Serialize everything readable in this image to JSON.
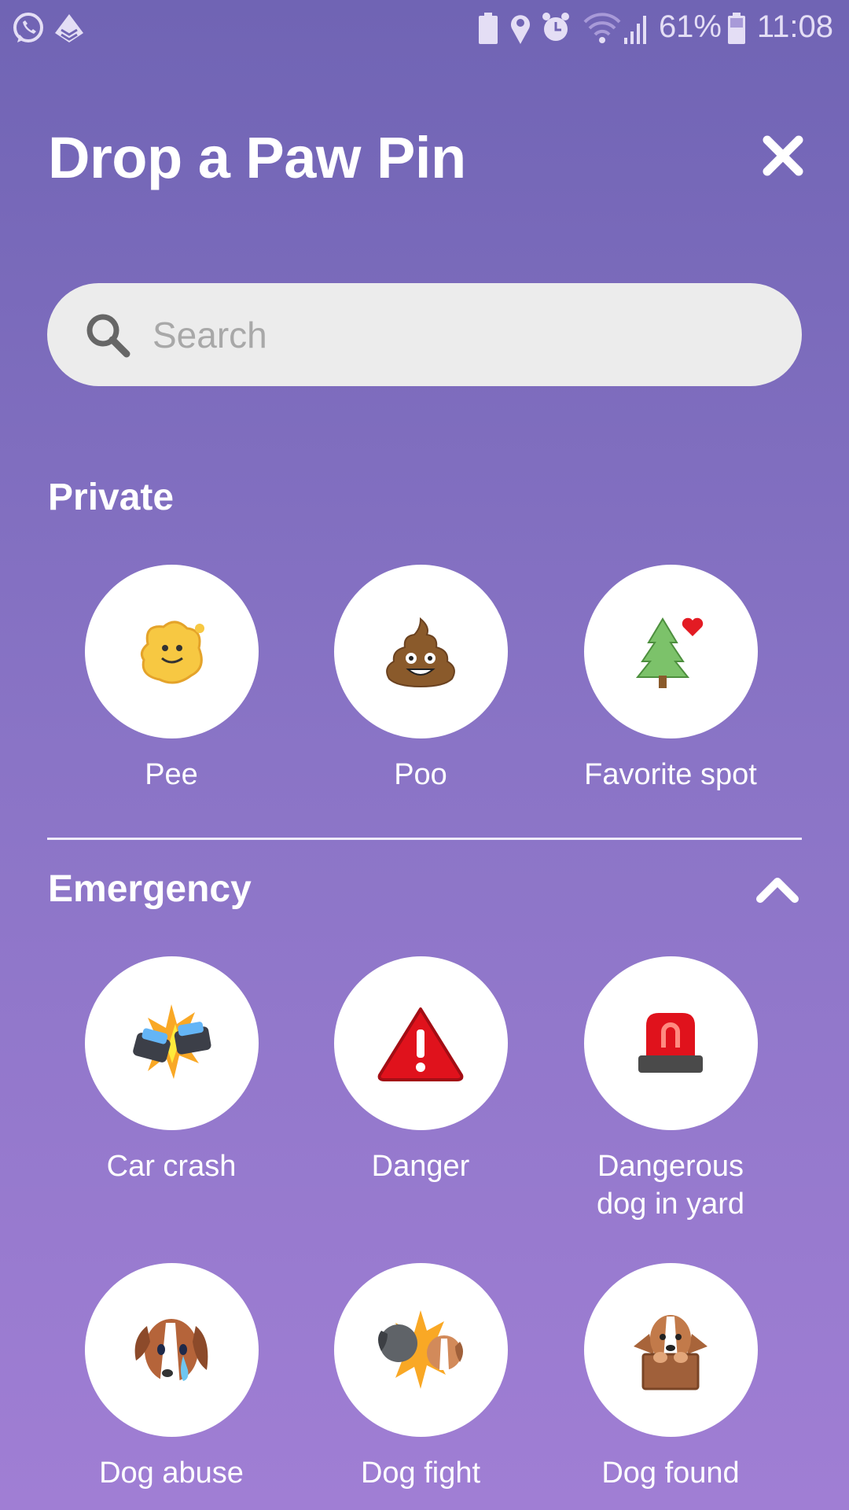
{
  "status_bar": {
    "battery_percent": "61%",
    "time": "11:08",
    "icons": [
      "whatsapp-icon",
      "layers-app-icon",
      "battery-saver-icon",
      "location-icon",
      "alarm-icon",
      "wifi-icon",
      "signal-icon",
      "battery-icon"
    ]
  },
  "header": {
    "title": "Drop a Paw Pin",
    "close_icon": "close-icon"
  },
  "search": {
    "placeholder": "Search",
    "value": ""
  },
  "sections": [
    {
      "title": "Private",
      "items": [
        {
          "label": "Pee",
          "icon": "pee-puddle-icon"
        },
        {
          "label": "Poo",
          "icon": "poo-icon"
        },
        {
          "label": "Favorite spot",
          "icon": "tree-heart-icon"
        }
      ]
    },
    {
      "title": "Emergency",
      "collapse_icon": "chevron-up-icon",
      "items": [
        {
          "label": "Car crash",
          "icon": "car-crash-icon"
        },
        {
          "label": "Danger",
          "icon": "warning-triangle-icon"
        },
        {
          "label": "Dangerous dog in yard",
          "icon": "siren-icon"
        },
        {
          "label": "Dog abuse",
          "icon": "crying-dog-icon"
        },
        {
          "label": "Dog fight",
          "icon": "dog-fight-icon"
        },
        {
          "label": "Dog found",
          "icon": "dog-in-box-icon"
        }
      ]
    }
  ],
  "colors": {
    "bg_top": "#7064b4",
    "bg_bottom": "#a07ed4",
    "circle": "#ffffff"
  }
}
